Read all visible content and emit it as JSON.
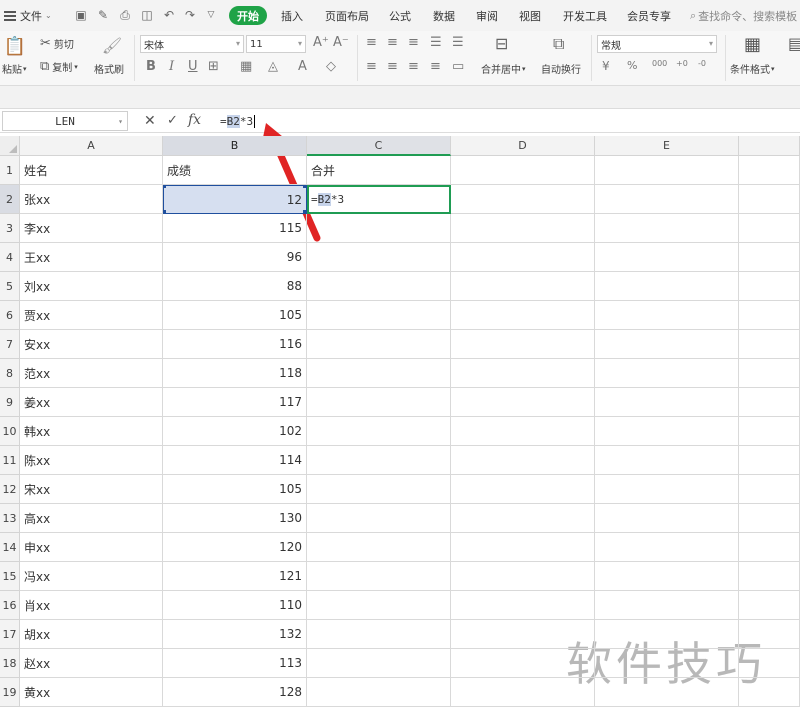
{
  "menu": {
    "file_label": "文件",
    "tabs": [
      "开始",
      "插入",
      "页面布局",
      "公式",
      "数据",
      "审阅",
      "视图",
      "开发工具",
      "会员专享"
    ],
    "search_placeholder": "查找命令、搜索模板"
  },
  "ribbon": {
    "paste": "粘贴",
    "cut": "剪切",
    "copy": "复制",
    "format_painter": "格式刷",
    "font_name": "宋体",
    "font_size": "11",
    "merge_center": "合并居中",
    "wrap": "自动换行",
    "number_format": "常规",
    "conditional_format": "条件格式"
  },
  "formula_bar": {
    "name_box": "LEN",
    "fx": "fx",
    "formula_prefix": "=",
    "formula_ref": "B2",
    "formula_suffix": "*3"
  },
  "columns": [
    "A",
    "B",
    "C",
    "D",
    "E"
  ],
  "rows": [
    {
      "n": "1",
      "a": "姓名",
      "b": "成绩"
    },
    {
      "n": "2",
      "a": "张xx",
      "b": "12"
    },
    {
      "n": "3",
      "a": "李xx",
      "b": "115"
    },
    {
      "n": "4",
      "a": "王xx",
      "b": "96"
    },
    {
      "n": "5",
      "a": "刘xx",
      "b": "88"
    },
    {
      "n": "6",
      "a": "贾xx",
      "b": "105"
    },
    {
      "n": "7",
      "a": "安xx",
      "b": "116"
    },
    {
      "n": "8",
      "a": "范xx",
      "b": "118"
    },
    {
      "n": "9",
      "a": "姜xx",
      "b": "117"
    },
    {
      "n": "10",
      "a": "韩xx",
      "b": "102"
    },
    {
      "n": "11",
      "a": "陈xx",
      "b": "114"
    },
    {
      "n": "12",
      "a": "宋xx",
      "b": "105"
    },
    {
      "n": "13",
      "a": "高xx",
      "b": "130"
    },
    {
      "n": "14",
      "a": "申xx",
      "b": "120"
    },
    {
      "n": "15",
      "a": "冯xx",
      "b": "121"
    },
    {
      "n": "16",
      "a": "肖xx",
      "b": "110"
    },
    {
      "n": "17",
      "a": "胡xx",
      "b": "132"
    },
    {
      "n": "18",
      "a": "赵xx",
      "b": "113"
    },
    {
      "n": "19",
      "a": "黄xx",
      "b": "128"
    }
  ],
  "c1": "合并",
  "c2": {
    "prefix": "=",
    "ref": "B2",
    "suffix": "*3"
  },
  "watermark": "软件技巧",
  "colors": {
    "accent": "#1fa347",
    "selection_border": "#1f4f9e",
    "edit_border": "#1f9c53",
    "arrow": "#e02424"
  }
}
